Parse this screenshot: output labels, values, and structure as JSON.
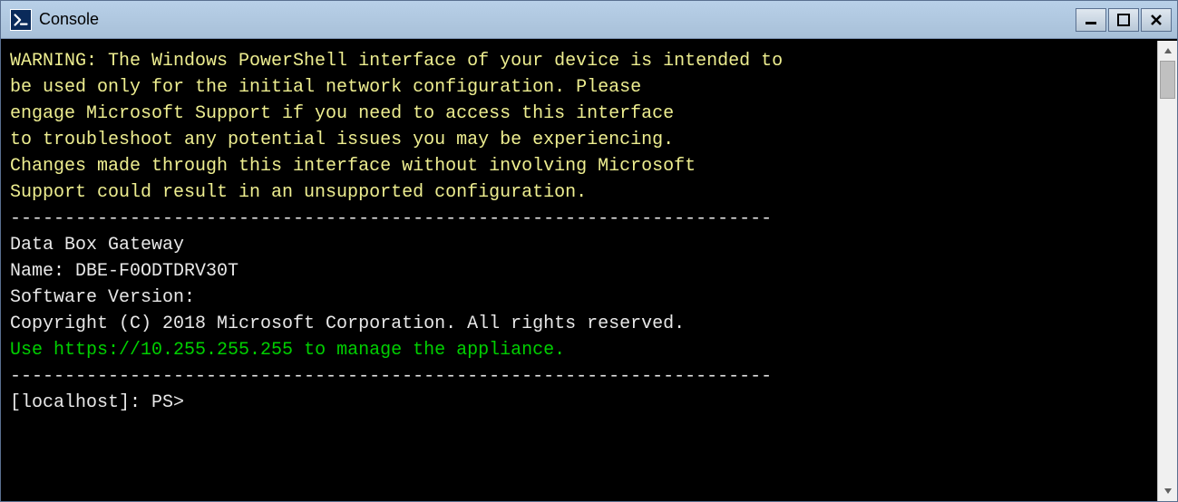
{
  "titlebar": {
    "title": "Console",
    "minimize_label": "─",
    "maximize_label": "□",
    "close_label": "✕"
  },
  "console": {
    "warning_line1": "WARNING: The Windows PowerShell interface of your device is intended to",
    "warning_line2": "be used only for the initial network configuration. Please",
    "warning_line3": "engage Microsoft Support if you need to access this interface",
    "warning_line4": "to troubleshoot any potential issues you may be experiencing.",
    "warning_line5": "Changes made through this interface without involving Microsoft",
    "warning_line6": "Support could result in an unsupported configuration.",
    "separator1": "----------------------------------------------------------------------",
    "product": "Data Box Gateway",
    "name": "Name: DBE-F0ODTDRV30T",
    "software_version": "Software Version:",
    "copyright": "Copyright (C) 2018 Microsoft Corporation. All rights reserved.",
    "manage_prefix": "Use ",
    "manage_url": "https://10.255.255.255",
    "manage_suffix": " to manage the appliance.",
    "separator2": "----------------------------------------------------------------------",
    "prompt": "[localhost]: PS>"
  }
}
